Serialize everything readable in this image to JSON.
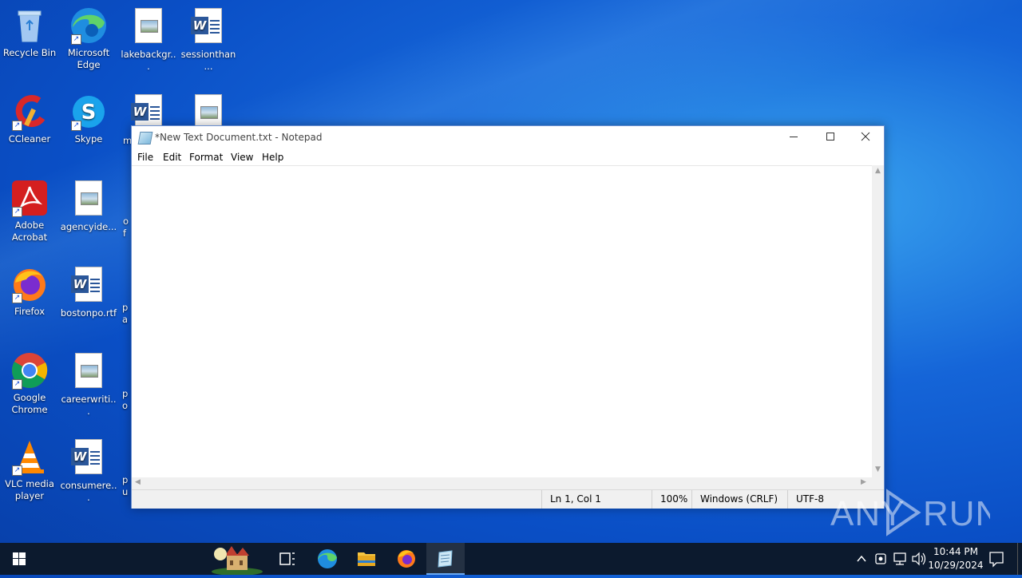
{
  "desktop": {
    "icons": [
      {
        "label": "Recycle Bin"
      },
      {
        "label": "Microsoft Edge"
      },
      {
        "label": "lakebackgr..."
      },
      {
        "label": "sessionthan..."
      },
      {
        "label": "CCleaner"
      },
      {
        "label": "Skype"
      },
      {
        "label": "m"
      },
      {
        "label": ""
      },
      {
        "label": "Adobe Acrobat"
      },
      {
        "label": "agencyide..."
      },
      {
        "label": "of"
      },
      {
        "label": "Firefox"
      },
      {
        "label": "bostonpo.rtf"
      },
      {
        "label": "pa"
      },
      {
        "label": "Google Chrome"
      },
      {
        "label": "careerwriti..."
      },
      {
        "label": "po"
      },
      {
        "label": "VLC media player"
      },
      {
        "label": "consumere..."
      },
      {
        "label": "pu"
      }
    ]
  },
  "notepad": {
    "title": "*New Text Document.txt - Notepad",
    "menu": [
      "File",
      "Edit",
      "Format",
      "View",
      "Help"
    ],
    "content": "",
    "status": {
      "position": "Ln 1, Col 1",
      "zoom": "100%",
      "line_ending": "Windows (CRLF)",
      "encoding": "UTF-8"
    }
  },
  "taskbar": {
    "time": "10:44 PM",
    "date": "10/29/2024",
    "accent": "#6aa9f0"
  },
  "watermark": "ANY RUN"
}
